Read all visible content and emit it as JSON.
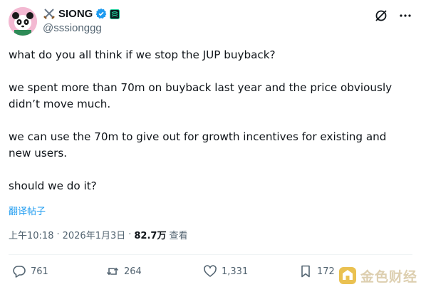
{
  "author": {
    "display_name": "SIONG",
    "handle": "@sssionggg",
    "name_prefix_icon": "crossed-swords-icon",
    "verified_icon": "verified-badge-icon",
    "affiliation_icon": "organization-badge-icon",
    "avatar": "panda-avatar"
  },
  "header_actions": {
    "grok_icon": "grok-icon",
    "more_icon": "more-icon"
  },
  "tweet": {
    "paragraphs": [
      "what do you all think if we stop the JUP buyback?",
      "we spent more than 70m on buyback last year and the price obviously didn’t move much.",
      "we can use the 70m to give out for growth incentives for existing and new users.",
      "should we do it?"
    ],
    "translate_label": "翻译帖子"
  },
  "meta": {
    "time": "上午10:18",
    "separator": "·",
    "date": "2026年1月3日",
    "separator2": "·",
    "views_count": "82.7万",
    "views_label": "查看"
  },
  "actions": {
    "reply_count": "761",
    "repost_count": "264",
    "like_count": "1,331",
    "bookmark_count": "172"
  },
  "watermark": {
    "text": "金色财经"
  },
  "colors": {
    "text_primary": "#0f1419",
    "text_secondary": "#536471",
    "link_blue": "#1d9bf0",
    "verified_blue": "#1d9bf0",
    "watermark_gold": "#e8b93a"
  }
}
